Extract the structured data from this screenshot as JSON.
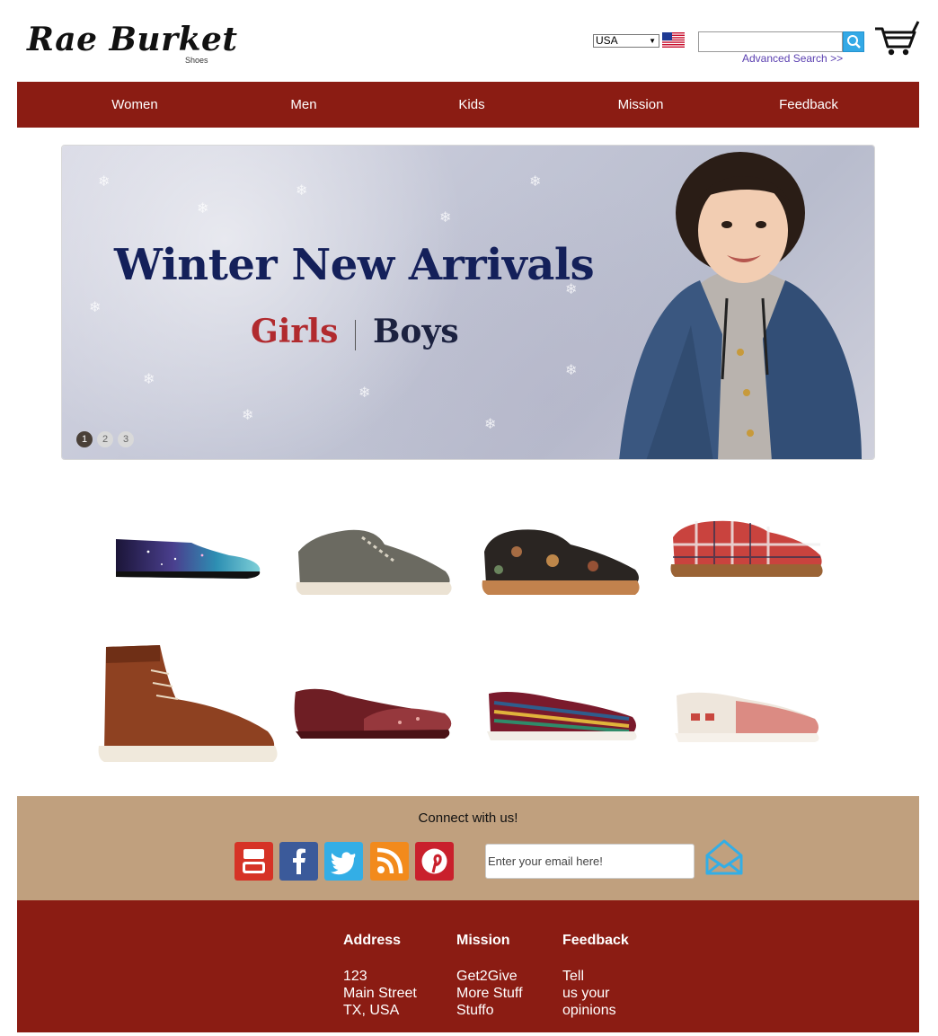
{
  "header": {
    "brand": "Rae Burket",
    "brand_sub": "Shoes",
    "country": "USA",
    "search_placeholder": "",
    "advanced_search": "Advanced Search >>",
    "icons": [
      "us-flag-icon",
      "search-icon",
      "cart-icon"
    ]
  },
  "nav": {
    "items": [
      "Women",
      "Men",
      "Kids",
      "Mission",
      "Feedback"
    ]
  },
  "banner": {
    "title": "Winter New Arrivals",
    "girls": "Girls",
    "boys": "Boys",
    "dots": [
      "1",
      "2",
      "3"
    ],
    "active_dot": 1
  },
  "products": {
    "row1": [
      "galaxy-print slip-on",
      "grey canvas chukka",
      "floral brocade oxford",
      "plaid sneaker"
    ],
    "row2": [
      "brown leather boot",
      "burgundy glitter flat",
      "tribal print slip-on",
      "red elephant print slip-on"
    ]
  },
  "connect": {
    "title": "Connect with us!",
    "email_placeholder": "Enter your email here!",
    "social": [
      "youtube-icon",
      "facebook-icon",
      "twitter-icon",
      "rss-icon",
      "pinterest-icon"
    ]
  },
  "footer": {
    "address": {
      "heading": "Address",
      "lines": [
        "123",
        "Main Street",
        "TX, USA"
      ]
    },
    "mission": {
      "heading": "Mission",
      "lines": [
        "Get2Give",
        "More Stuff",
        "Stuffo"
      ]
    },
    "feedback": {
      "heading": "Feedback",
      "lines": [
        "Tell",
        "us your",
        "opinions"
      ]
    }
  },
  "colors": {
    "nav_bg": "#8b1c13",
    "connect_bg": "#c0a07e",
    "search_btn": "#33a9e6",
    "link": "#5a3fb0"
  }
}
